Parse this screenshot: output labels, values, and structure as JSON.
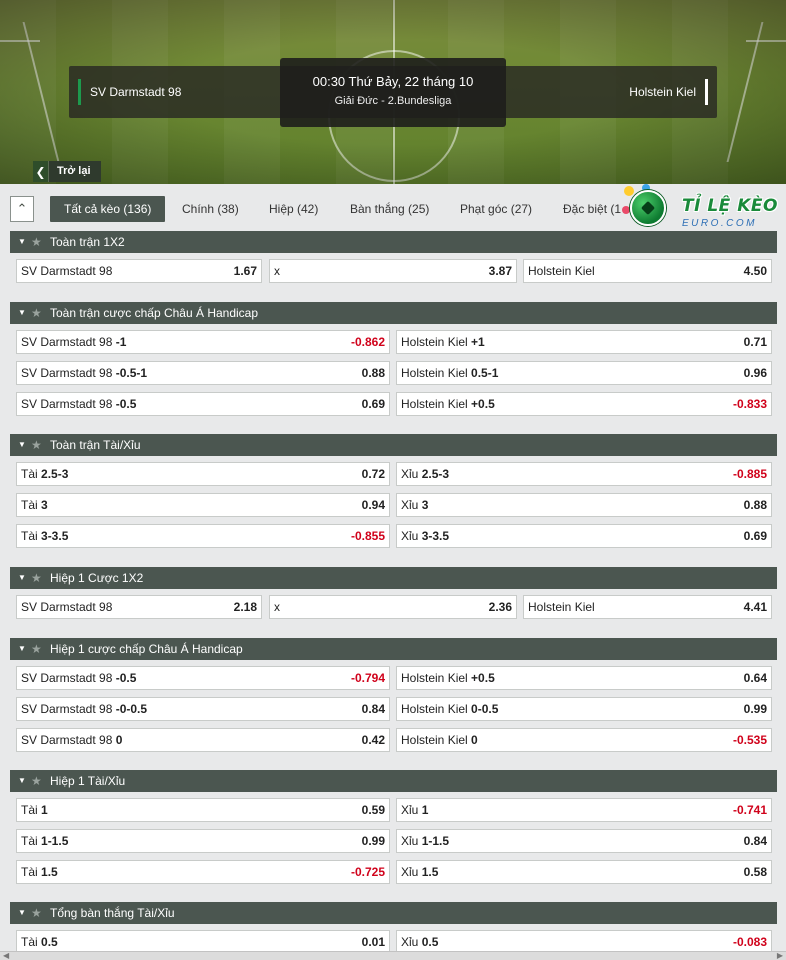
{
  "match": {
    "home": "SV Darmstadt 98",
    "away": "Holstein Kiel",
    "datetime": "00:30 Thứ Bảy, 22 tháng 10",
    "league": "Giải Đức - 2.Bundesliga"
  },
  "nav": {
    "back_label": "Trở lại"
  },
  "tabs": [
    {
      "label": "Tất cả kèo (136)",
      "active": true
    },
    {
      "label": "Chính (38)"
    },
    {
      "label": "Hiệp (42)"
    },
    {
      "label": "Bàn thắng (25)"
    },
    {
      "label": "Phạt góc (27)"
    },
    {
      "label": "Đặc biệt (1"
    }
  ],
  "logo": {
    "title": "TỈ LỆ KÈO",
    "sub": "EURO.COM"
  },
  "sections": [
    {
      "title": "Toàn trận 1X2",
      "rows": [
        [
          {
            "label": "SV Darmstadt 98",
            "hc": "",
            "odd": "1.67"
          },
          {
            "label": "x",
            "hc": "",
            "odd": "3.87"
          },
          {
            "label": "Holstein Kiel",
            "hc": "",
            "odd": "4.50"
          }
        ]
      ]
    },
    {
      "title": "Toàn trận cược chấp Châu Á Handicap",
      "rows": [
        [
          {
            "label": "SV Darmstadt 98",
            "hc": "-1",
            "odd": "-0.862"
          },
          {
            "label": "Holstein Kiel",
            "hc": "+1",
            "odd": "0.71"
          }
        ],
        [
          {
            "label": "SV Darmstadt 98",
            "hc": "-0.5-1",
            "odd": "0.88"
          },
          {
            "label": "Holstein Kiel",
            "hc": "0.5-1",
            "odd": "0.96"
          }
        ],
        [
          {
            "label": "SV Darmstadt 98",
            "hc": "-0.5",
            "odd": "0.69"
          },
          {
            "label": "Holstein Kiel",
            "hc": "+0.5",
            "odd": "-0.833"
          }
        ]
      ]
    },
    {
      "title": "Toàn trận Tài/Xỉu",
      "rows": [
        [
          {
            "label": "Tài",
            "hc": "2.5-3",
            "odd": "0.72"
          },
          {
            "label": "Xỉu",
            "hc": "2.5-3",
            "odd": "-0.885"
          }
        ],
        [
          {
            "label": "Tài",
            "hc": "3",
            "odd": "0.94"
          },
          {
            "label": "Xỉu",
            "hc": "3",
            "odd": "0.88"
          }
        ],
        [
          {
            "label": "Tài",
            "hc": "3-3.5",
            "odd": "-0.855"
          },
          {
            "label": "Xỉu",
            "hc": "3-3.5",
            "odd": "0.69"
          }
        ]
      ]
    },
    {
      "title": "Hiệp 1 Cược 1X2",
      "rows": [
        [
          {
            "label": "SV Darmstadt 98",
            "hc": "",
            "odd": "2.18"
          },
          {
            "label": "x",
            "hc": "",
            "odd": "2.36"
          },
          {
            "label": "Holstein Kiel",
            "hc": "",
            "odd": "4.41"
          }
        ]
      ]
    },
    {
      "title": "Hiệp 1 cược chấp Châu Á Handicap",
      "rows": [
        [
          {
            "label": "SV Darmstadt 98",
            "hc": "-0.5",
            "odd": "-0.794"
          },
          {
            "label": "Holstein Kiel",
            "hc": "+0.5",
            "odd": "0.64"
          }
        ],
        [
          {
            "label": "SV Darmstadt 98",
            "hc": "-0-0.5",
            "odd": "0.84"
          },
          {
            "label": "Holstein Kiel",
            "hc": "0-0.5",
            "odd": "0.99"
          }
        ],
        [
          {
            "label": "SV Darmstadt 98",
            "hc": "0",
            "odd": "0.42"
          },
          {
            "label": "Holstein Kiel",
            "hc": "0",
            "odd": "-0.535"
          }
        ]
      ]
    },
    {
      "title": "Hiệp 1 Tài/Xỉu",
      "rows": [
        [
          {
            "label": "Tài",
            "hc": "1",
            "odd": "0.59"
          },
          {
            "label": "Xỉu",
            "hc": "1",
            "odd": "-0.741"
          }
        ],
        [
          {
            "label": "Tài",
            "hc": "1-1.5",
            "odd": "0.99"
          },
          {
            "label": "Xỉu",
            "hc": "1-1.5",
            "odd": "0.84"
          }
        ],
        [
          {
            "label": "Tài",
            "hc": "1.5",
            "odd": "-0.725"
          },
          {
            "label": "Xỉu",
            "hc": "1.5",
            "odd": "0.58"
          }
        ]
      ]
    },
    {
      "title": "Tổng bàn thắng Tài/Xỉu",
      "rows": [
        [
          {
            "label": "Tài",
            "hc": "0.5",
            "odd": "0.01"
          },
          {
            "label": "Xỉu",
            "hc": "0.5",
            "odd": "-0.083"
          }
        ]
      ]
    }
  ]
}
